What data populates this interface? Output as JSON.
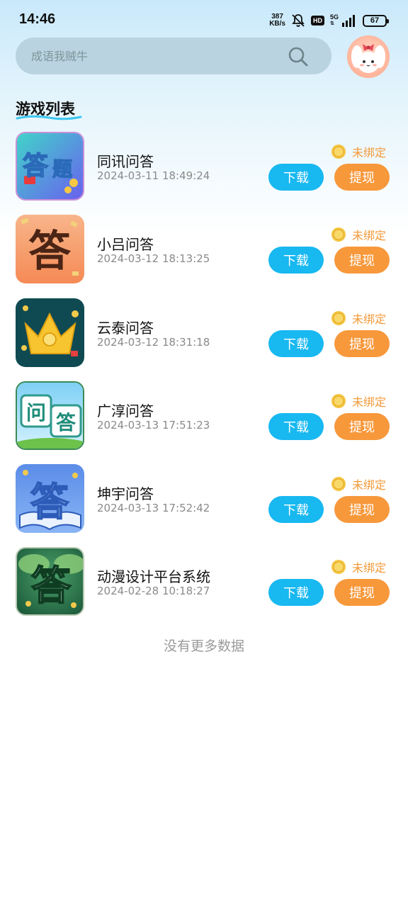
{
  "status_bar": {
    "time": "14:46",
    "net_speed_value": "387",
    "net_speed_unit": "KB/s",
    "hd": "HD",
    "net_type": "5G",
    "battery": "67"
  },
  "search": {
    "placeholder": "成语我贼牛"
  },
  "section_title": "游戏列表",
  "games": [
    {
      "name": "同讯问答",
      "date": "2024-03-11 18:49:24",
      "bind_status": "未绑定",
      "download_label": "下载",
      "withdraw_label": "提现"
    },
    {
      "name": "小吕问答",
      "date": "2024-03-12 18:13:25",
      "bind_status": "未绑定",
      "download_label": "下载",
      "withdraw_label": "提现"
    },
    {
      "name": "云泰问答",
      "date": "2024-03-12 18:31:18",
      "bind_status": "未绑定",
      "download_label": "下载",
      "withdraw_label": "提现"
    },
    {
      "name": "广淳问答",
      "date": "2024-03-13 17:51:23",
      "bind_status": "未绑定",
      "download_label": "下载",
      "withdraw_label": "提现"
    },
    {
      "name": "坤宇问答",
      "date": "2024-03-13 17:52:42",
      "bind_status": "未绑定",
      "download_label": "下载",
      "withdraw_label": "提现"
    },
    {
      "name": "动漫设计平台系统",
      "date": "2024-02-28 10:18:27",
      "bind_status": "未绑定",
      "download_label": "下载",
      "withdraw_label": "提现"
    }
  ],
  "icon_texts": {
    "icon1_a": "答",
    "icon1_b": "题",
    "icon2": "答",
    "icon4_a": "问",
    "icon4_b": "答",
    "icon5": "答",
    "icon6": "答"
  },
  "no_more_text": "没有更多数据",
  "colors": {
    "download_button": "#18b8f0",
    "withdraw_button": "#f7983b",
    "bind_status": "#f39a38",
    "search_bg": "#b9d4e0"
  },
  "icons": {
    "search": "search-icon",
    "coin": "coin-icon",
    "mute": "bell-off-icon",
    "signal": "signal-icon",
    "battery": "battery-icon"
  }
}
